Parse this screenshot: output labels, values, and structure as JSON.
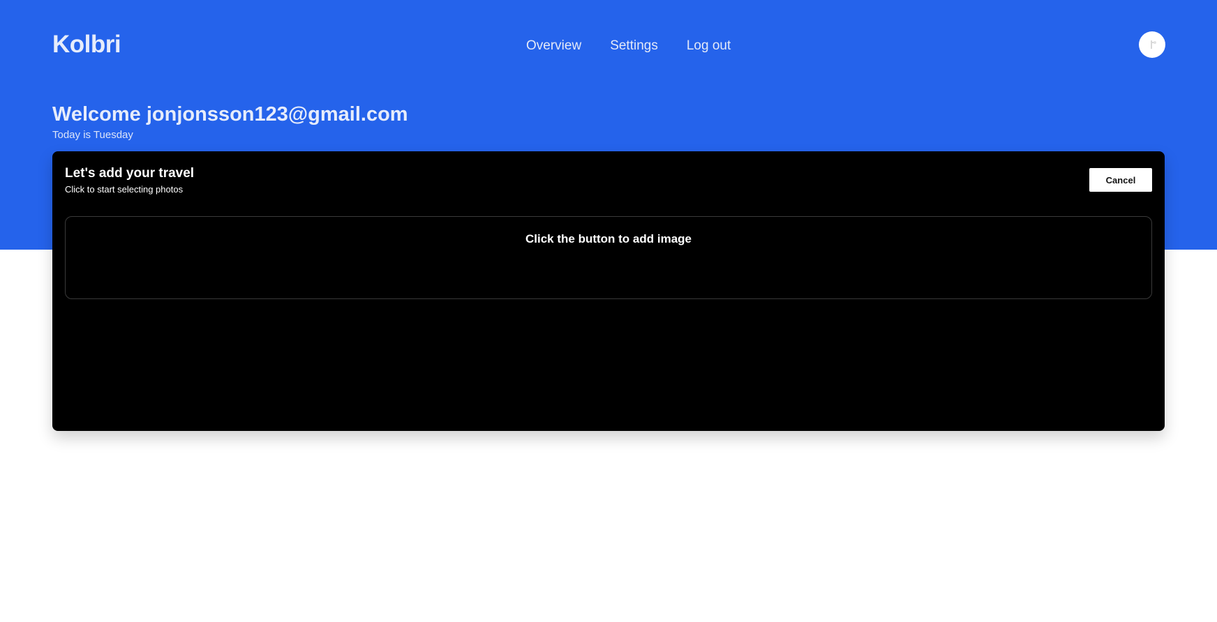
{
  "app": {
    "brand": "Kolbri"
  },
  "nav": {
    "items": [
      {
        "label": "Overview"
      },
      {
        "label": "Settings"
      },
      {
        "label": "Log out"
      }
    ]
  },
  "header": {
    "welcome": "Welcome jonjonsson123@gmail.com",
    "today": "Today is Tuesday"
  },
  "card": {
    "title": "Let's add your travel",
    "subtitle": "Click to start selecting photos",
    "cancel_label": "Cancel",
    "dropzone_text": "Click the button to add image"
  },
  "colors": {
    "brand_blue": "#2563eb",
    "card_background": "#000000",
    "page_background": "#ffffff"
  },
  "icons": {
    "avatar": "user-avatar-icon"
  }
}
